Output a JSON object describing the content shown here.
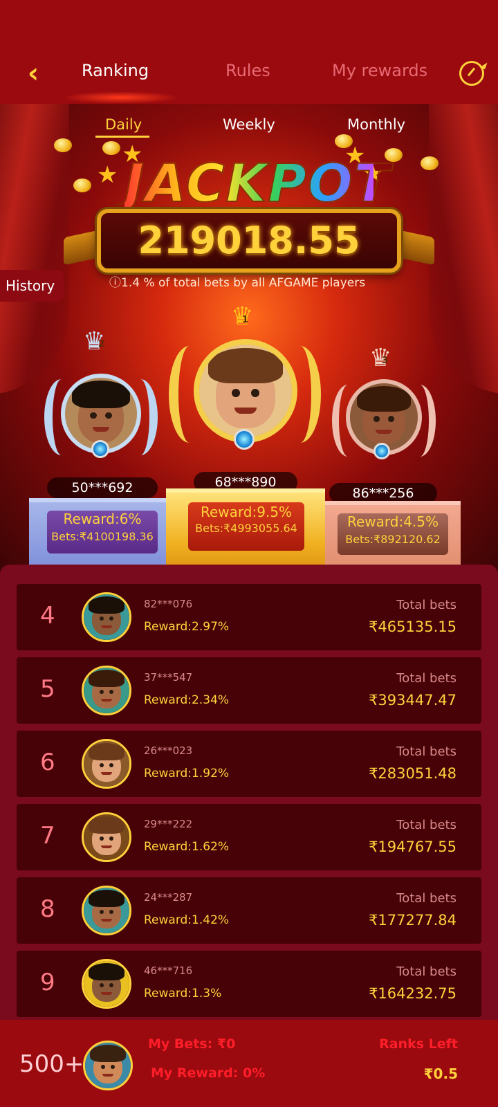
{
  "header": {
    "tabs": [
      {
        "label": "Ranking",
        "active": true
      },
      {
        "label": "Rules",
        "active": false
      },
      {
        "label": "My rewards",
        "active": false
      }
    ],
    "back_icon": "back-arrow-icon",
    "refresh_icon": "refresh-icon"
  },
  "periods": [
    {
      "label": "Daily",
      "active": true
    },
    {
      "label": "Weekly",
      "active": false
    },
    {
      "label": "Monthly",
      "active": false
    }
  ],
  "jackpot": {
    "word": "JACKPOT",
    "amount": "219018.55",
    "note": "ⓘ1.4 % of total bets by all AFGAME players"
  },
  "history_label": "History",
  "podium": [
    {
      "rank": 2,
      "id": "50***692",
      "reward": "Reward:6%",
      "bets": "Bets:₹4100198.36"
    },
    {
      "rank": 1,
      "id": "68***890",
      "reward": "Reward:9.5%",
      "bets": "Bets:₹4993055.64"
    },
    {
      "rank": 3,
      "id": "86***256",
      "reward": "Reward:4.5%",
      "bets": "Bets:₹892120.62"
    }
  ],
  "list": [
    {
      "rank": "4",
      "id": "82***076",
      "reward": "Reward:2.97%",
      "total_label": "Total bets",
      "total": "₹465135.15"
    },
    {
      "rank": "5",
      "id": "37***547",
      "reward": "Reward:2.34%",
      "total_label": "Total bets",
      "total": "₹393447.47"
    },
    {
      "rank": "6",
      "id": "26***023",
      "reward": "Reward:1.92%",
      "total_label": "Total bets",
      "total": "₹283051.48"
    },
    {
      "rank": "7",
      "id": "29***222",
      "reward": "Reward:1.62%",
      "total_label": "Total bets",
      "total": "₹194767.55"
    },
    {
      "rank": "8",
      "id": "24***287",
      "reward": "Reward:1.42%",
      "total_label": "Total bets",
      "total": "₹177277.84"
    },
    {
      "rank": "9",
      "id": "46***716",
      "reward": "Reward:1.3%",
      "total_label": "Total bets",
      "total": "₹164232.75"
    }
  ],
  "me": {
    "rank": "500+",
    "bets": "My Bets:  ₹0",
    "reward": "My Reward: 0%",
    "ranks_left_label": "Ranks Left",
    "ranks_left_value": "₹0.5"
  },
  "colors": {
    "accent_gold": "#ffd23c",
    "header_red": "#9b0a0e",
    "row_bg": "#470207",
    "list_bg": "#7a0a1e",
    "warning_red": "#ff1e2a"
  }
}
